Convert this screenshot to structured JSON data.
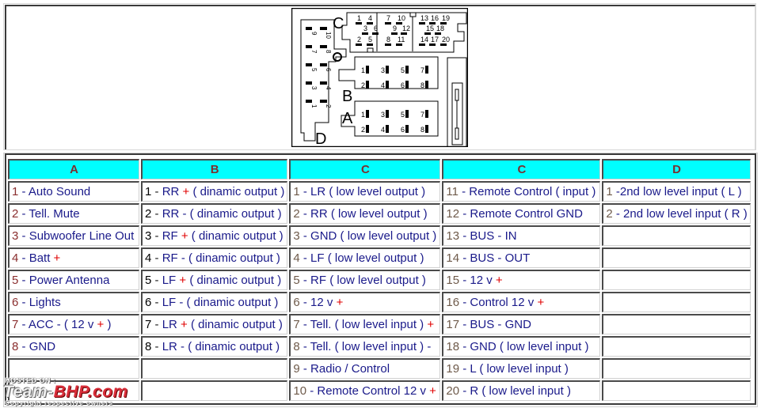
{
  "diagram": {
    "connector_labels": [
      "A",
      "B",
      "C",
      "D"
    ],
    "connector_c_pins": [
      "1",
      "2",
      "3",
      "4",
      "5",
      "6",
      "7",
      "8",
      "9",
      "10",
      "11",
      "12",
      "13",
      "14",
      "15",
      "16",
      "17",
      "18",
      "19",
      "20"
    ],
    "connector_d_pins": [
      "1",
      "2",
      "3",
      "4",
      "5",
      "6",
      "7",
      "8",
      "9",
      "10"
    ],
    "connector_a_pins": [
      "1",
      "2",
      "3",
      "4",
      "5",
      "6",
      "7",
      "8"
    ],
    "connector_b_pins": [
      "1",
      "2",
      "3",
      "4",
      "5",
      "6",
      "7",
      "8"
    ]
  },
  "table": {
    "headers": [
      "A",
      "B",
      "C",
      "C",
      "D"
    ],
    "rows": [
      [
        {
          "n": "1",
          "t": "Auto Sound"
        },
        {
          "n": "1",
          "t": "RR",
          "plus": true,
          "s": "( dinamic output )"
        },
        {
          "n": "1",
          "t": "LR ( low level output )"
        },
        {
          "n": "11",
          "t": "Remote Control ( input )"
        },
        {
          "n": "1",
          "t": "-2nd low level input ( L )",
          "nodash": true
        }
      ],
      [
        {
          "n": "2",
          "t": "Tell. Mute"
        },
        {
          "n": "2",
          "t": "RR - ( dinamic output )"
        },
        {
          "n": "2",
          "t": "RR ( low level output )"
        },
        {
          "n": "12",
          "t": "Remote Control GND"
        },
        {
          "n": "2",
          "t": "2nd low level input ( R )"
        }
      ],
      [
        {
          "n": "3",
          "t": "Subwoofer Line Out"
        },
        {
          "n": "3",
          "t": "RF",
          "plus": true,
          "s": "( dinamic output )"
        },
        {
          "n": "3",
          "t": "GND ( low level output )"
        },
        {
          "n": "13",
          "t": "BUS - IN"
        },
        null
      ],
      [
        {
          "n": "4",
          "t": "Batt",
          "plus": true,
          "s": ""
        },
        {
          "n": "4",
          "t": "RF - ( dinamic output )"
        },
        {
          "n": "4",
          "t": "LF ( low level output )"
        },
        {
          "n": "14",
          "t": "BUS - OUT"
        },
        null
      ],
      [
        {
          "n": "5",
          "t": "Power Antenna"
        },
        {
          "n": "5",
          "t": "LF",
          "plus": true,
          "s": "( dinamic output )"
        },
        {
          "n": "5",
          "t": "RF ( low level output )"
        },
        {
          "n": "15",
          "t": "12 v",
          "plus": true,
          "s": ""
        },
        null
      ],
      [
        {
          "n": "6",
          "t": "Lights"
        },
        {
          "n": "6",
          "t": "LF - ( dinamic output )"
        },
        {
          "n": "6",
          "t": "12 v",
          "plus": true,
          "s": ""
        },
        {
          "n": "16",
          "t": "Control 12 v",
          "plus": true,
          "s": ""
        },
        null
      ],
      [
        {
          "n": "7",
          "t": "ACC - ( 12 v",
          "plus": true,
          "s": ")"
        },
        {
          "n": "7",
          "t": "LR",
          "plus": true,
          "s": "( dinamic output )"
        },
        {
          "n": "7",
          "t": "Tell. ( low level input )",
          "plus": true,
          "s": ""
        },
        {
          "n": "17",
          "t": "BUS - GND"
        },
        null
      ],
      [
        {
          "n": "8",
          "t": "GND"
        },
        {
          "n": "8",
          "t": "LR - ( dinamic output )"
        },
        {
          "n": "8",
          "t": "Tell. ( low level input ) -"
        },
        {
          "n": "18",
          "t": "GND ( low level input )"
        },
        null
      ],
      [
        null,
        null,
        {
          "n": "9",
          "t": "Radio / Control"
        },
        {
          "n": "19",
          "t": "L ( low level input )"
        },
        null
      ],
      [
        null,
        null,
        {
          "n": "10",
          "t": "Remote Control 12 v",
          "plus": true,
          "s": ""
        },
        {
          "n": "20",
          "t": "R ( low level input )"
        },
        null
      ]
    ]
  },
  "symbols": {
    "plus": "+",
    "dash": " - "
  },
  "watermark": {
    "hosted": "HOSTED ON :",
    "brand_a": "Team-",
    "brand_b": "BHP.com",
    "copyright": "Copyright respective owners"
  },
  "colors": {
    "header_bg": "#00ffff",
    "header_text": "#7a3030",
    "body_text": "#1a1a8a",
    "plus": "#e00000",
    "num_a": "#8a2e2e",
    "num_b": "#000000",
    "num_c": "#6e5a4a"
  }
}
